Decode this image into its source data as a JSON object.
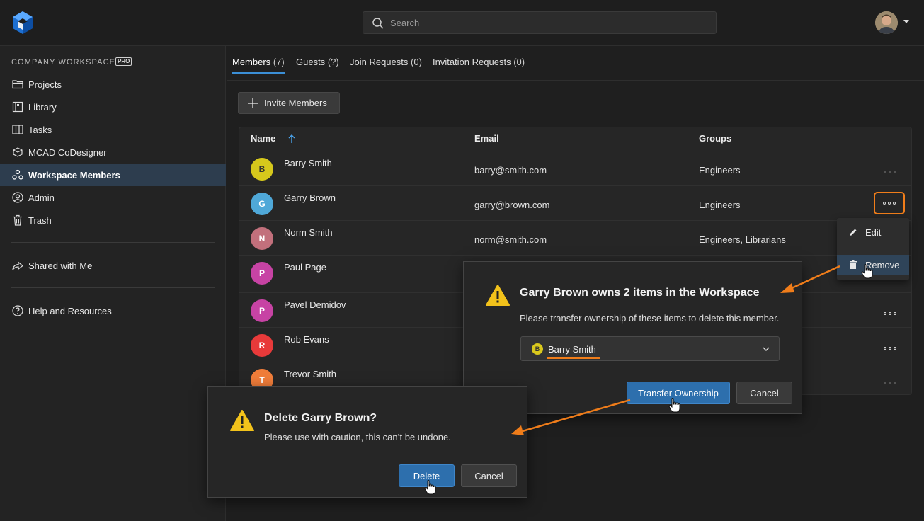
{
  "header": {
    "search_placeholder": "Search",
    "logo_icon": "app-logo-icon",
    "avatar_icon": "user-avatar"
  },
  "sidebar": {
    "workspace_title": "COMPANY WORKSPACE",
    "badge": "PRO",
    "items": [
      {
        "label": "Projects",
        "icon": "folder-icon"
      },
      {
        "label": "Library",
        "icon": "library-icon"
      },
      {
        "label": "Tasks",
        "icon": "tasks-icon"
      },
      {
        "label": "MCAD CoDesigner",
        "icon": "mcad-icon"
      },
      {
        "label": "Workspace Members",
        "icon": "members-icon",
        "active": true
      },
      {
        "label": "Admin",
        "icon": "admin-icon"
      },
      {
        "label": "Trash",
        "icon": "trash-icon"
      }
    ],
    "shared": "Shared with Me",
    "help": "Help and Resources"
  },
  "tabs": [
    {
      "label": "Members",
      "count": "(7)",
      "active": true
    },
    {
      "label": "Guests",
      "count": "(?)"
    },
    {
      "label": "Join Requests",
      "count": "(0)"
    },
    {
      "label": "Invitation Requests",
      "count": "(0)"
    }
  ],
  "invite_label": "Invite Members",
  "table": {
    "headers": {
      "name": "Name",
      "email": "Email",
      "groups": "Groups"
    },
    "rows": [
      {
        "initial": "B",
        "color": "#d6c81c",
        "name": "Barry Smith",
        "email": "barry@smith.com",
        "groups": "Engineers"
      },
      {
        "initial": "G",
        "color": "#4fa8d8",
        "name": "Garry Brown",
        "email": "garry@brown.com",
        "groups": "Engineers"
      },
      {
        "initial": "N",
        "color": "#c2707c",
        "name": "Norm Smith",
        "email": "norm@smith.com",
        "groups": "Engineers, Librarians"
      },
      {
        "initial": "P",
        "color": "#c743a4",
        "name": "Paul Page",
        "email": "",
        "groups": ""
      },
      {
        "initial": "P",
        "color": "#c743a4",
        "name": "Pavel Demidov",
        "email": "",
        "groups": ""
      },
      {
        "initial": "R",
        "color": "#e83a3a",
        "name": "Rob Evans",
        "email": "",
        "groups": ""
      },
      {
        "initial": "T",
        "color": "#f07d3a",
        "name": "Trevor Smith",
        "email": "",
        "groups": ""
      }
    ]
  },
  "context_menu": {
    "edit": "Edit",
    "remove": "Remove"
  },
  "transfer_dialog": {
    "title": "Garry Brown owns 2 items in the Workspace",
    "text": "Please transfer ownership of these items to delete this member.",
    "selected_initial": "B",
    "selected": "Barry Smith",
    "confirm": "Transfer Ownership",
    "cancel": "Cancel"
  },
  "delete_dialog": {
    "title": "Delete Garry Brown?",
    "text": "Please use with caution, this can’t be undone.",
    "confirm": "Delete",
    "cancel": "Cancel"
  },
  "colors": {
    "accent": "#2d6fad",
    "annotation": "#f07d1a",
    "warning": "#f2c21b"
  }
}
